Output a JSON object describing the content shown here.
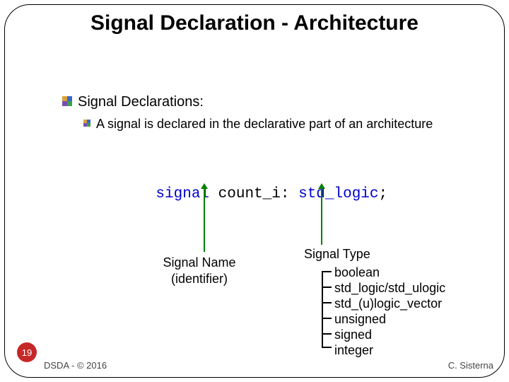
{
  "title": "Signal Declaration - Architecture",
  "bullets": {
    "l1": "Signal Declarations:",
    "l2": "A signal is declared in the declarative part of an architecture"
  },
  "code": {
    "kw_signal": "signal",
    "ident": "count_i",
    "colon": ":",
    "type": "std_logic",
    "semi": ";"
  },
  "labels": {
    "name_line1": "Signal Name",
    "name_line2": "(identifier)",
    "type_title": "Signal Type"
  },
  "type_options": [
    "boolean",
    "std_logic/std_ulogic",
    "std_(u)logic_vector",
    "unsigned",
    "signed",
    "integer"
  ],
  "footer": {
    "page": "19",
    "left": "DSDA - © 2016",
    "right": "C. Sisterna"
  }
}
